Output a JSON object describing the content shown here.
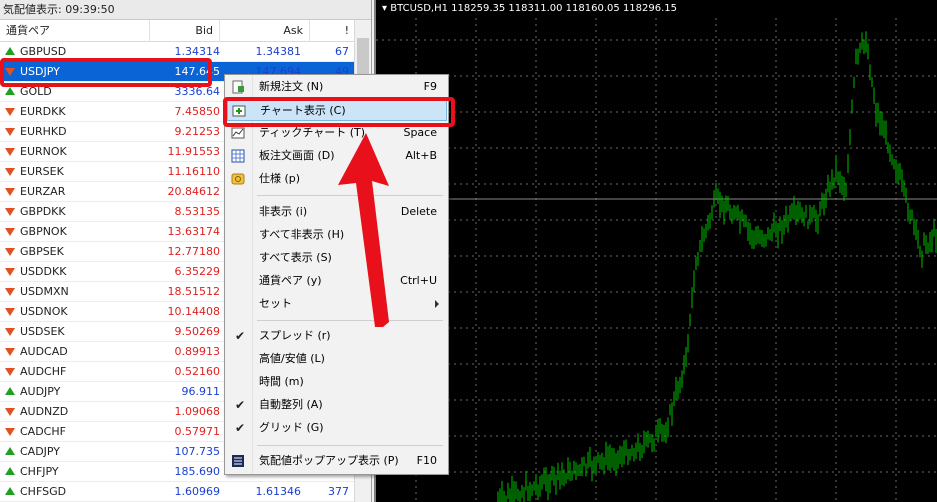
{
  "market_watch": {
    "title": "気配値表示: 09:39:50",
    "columns": {
      "symbol": "通貨ペア",
      "bid": "Bid",
      "ask": "Ask",
      "spread": "!"
    },
    "rows": [
      {
        "symbol": "GBPUSD",
        "dir": "up",
        "bid": "1.34314",
        "ask": "1.34381",
        "spread": "67"
      },
      {
        "symbol": "USDJPY",
        "dir": "down",
        "bid": "147.645",
        "ask": "147.694",
        "spread": "49",
        "selected": true
      },
      {
        "symbol": "GOLD",
        "dir": "up",
        "bid": "3336.64",
        "ask": "",
        "spread": ""
      },
      {
        "symbol": "EURDKK",
        "dir": "down",
        "bid": "7.45850",
        "ask": "",
        "spread": ""
      },
      {
        "symbol": "EURHKD",
        "dir": "down",
        "bid": "9.21253",
        "ask": "",
        "spread": ""
      },
      {
        "symbol": "EURNOK",
        "dir": "down",
        "bid": "11.91553",
        "ask": "",
        "spread": ""
      },
      {
        "symbol": "EURSEK",
        "dir": "down",
        "bid": "11.16110",
        "ask": "",
        "spread": ""
      },
      {
        "symbol": "EURZAR",
        "dir": "down",
        "bid": "20.84612",
        "ask": "",
        "spread": ""
      },
      {
        "symbol": "GBPDKK",
        "dir": "down",
        "bid": "8.53135",
        "ask": "",
        "spread": ""
      },
      {
        "symbol": "GBPNOK",
        "dir": "down",
        "bid": "13.63174",
        "ask": "",
        "spread": ""
      },
      {
        "symbol": "GBPSEK",
        "dir": "down",
        "bid": "12.77180",
        "ask": "",
        "spread": ""
      },
      {
        "symbol": "USDDKK",
        "dir": "down",
        "bid": "6.35229",
        "ask": "",
        "spread": ""
      },
      {
        "symbol": "USDMXN",
        "dir": "down",
        "bid": "18.51512",
        "ask": "",
        "spread": ""
      },
      {
        "symbol": "USDNOK",
        "dir": "down",
        "bid": "10.14408",
        "ask": "",
        "spread": ""
      },
      {
        "symbol": "USDSEK",
        "dir": "down",
        "bid": "9.50269",
        "ask": "",
        "spread": ""
      },
      {
        "symbol": "AUDCAD",
        "dir": "down",
        "bid": "0.89913",
        "ask": "",
        "spread": ""
      },
      {
        "symbol": "AUDCHF",
        "dir": "down",
        "bid": "0.52160",
        "ask": "",
        "spread": ""
      },
      {
        "symbol": "AUDJPY",
        "dir": "up",
        "bid": "96.911",
        "ask": "",
        "spread": ""
      },
      {
        "symbol": "AUDNZD",
        "dir": "down",
        "bid": "1.09068",
        "ask": "",
        "spread": ""
      },
      {
        "symbol": "CADCHF",
        "dir": "down",
        "bid": "0.57971",
        "ask": "",
        "spread": ""
      },
      {
        "symbol": "CADJPY",
        "dir": "up",
        "bid": "107.735",
        "ask": "",
        "spread": ""
      },
      {
        "symbol": "CHFJPY",
        "dir": "up",
        "bid": "185.690",
        "ask": "",
        "spread": ""
      },
      {
        "symbol": "CHFSGD",
        "dir": "up",
        "bid": "1.60969",
        "ask": "1.61346",
        "spread": "377"
      }
    ]
  },
  "chart": {
    "title": "BTCUSD,H1  118259.35 118311.00 118160.05 118296.15"
  },
  "context_menu": {
    "items": [
      {
        "label": "新規注文 (N)",
        "shortcut": "F9",
        "icon": "new-order-icon"
      },
      {
        "label": "チャート表示 (C)",
        "shortcut": "",
        "icon": "chart-window-icon",
        "active": true
      },
      {
        "label": "ティックチャート (T)",
        "shortcut": "Space",
        "icon": "tick-chart-icon"
      },
      {
        "label": "板注文画面 (D)",
        "shortcut": "Alt+B",
        "icon": "depth-of-market-icon"
      },
      {
        "label": "仕様 (p)",
        "shortcut": "",
        "icon": "specification-icon"
      },
      {
        "label": "非表示 (i)",
        "shortcut": "Delete"
      },
      {
        "label": "すべて非表示 (H)",
        "shortcut": ""
      },
      {
        "label": "すべて表示 (S)",
        "shortcut": ""
      },
      {
        "label": "通貨ペア (y)",
        "shortcut": "Ctrl+U"
      },
      {
        "label": "セット",
        "shortcut": "",
        "submenu": true
      },
      {
        "label": "スプレッド (r)",
        "checked": true
      },
      {
        "label": "高値/安値 (L)",
        "checked": false
      },
      {
        "label": "時間 (m)",
        "checked": false
      },
      {
        "label": "自動整列 (A)",
        "checked": true
      },
      {
        "label": "グリッド (G)",
        "checked": true
      },
      {
        "label": "気配値ポップアップ表示 (P)",
        "shortcut": "F10",
        "icon": "popup-prices-icon"
      }
    ]
  },
  "colors": {
    "highlight": "#e8101a",
    "selection": "#0a64d6",
    "bid_down": "#e02020",
    "bid_up": "#1a3fd0",
    "candle": "#00c000",
    "chart_bg": "#000000"
  }
}
